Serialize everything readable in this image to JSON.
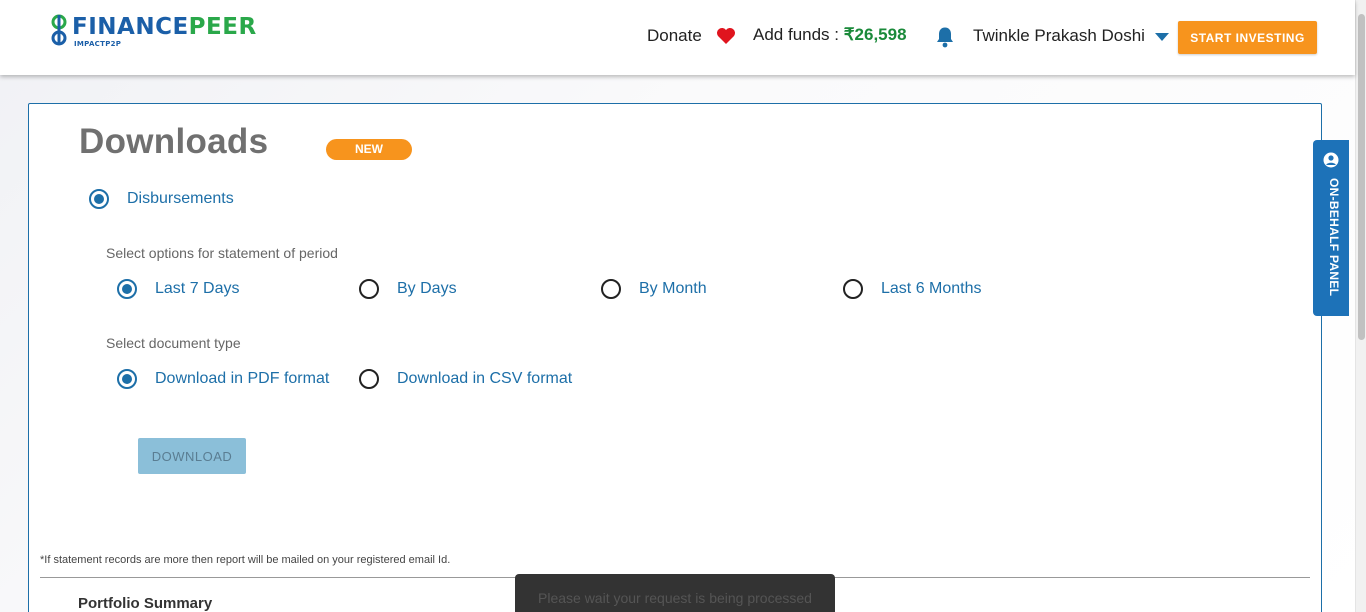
{
  "header": {
    "logo": {
      "brand_part1": "FINANCE",
      "brand_part2": "PEER",
      "tagline": "IMPACTP2P"
    },
    "donate_label": "Donate",
    "funds_label": "Add funds : ",
    "funds_amount": "₹26,598",
    "user_name": "Twinkle Prakash Doshi",
    "start_investing_label": "START INVESTING"
  },
  "page": {
    "title": "Downloads",
    "badge": "NEW",
    "report_type": {
      "label": "Disbursements",
      "selected": true
    },
    "period": {
      "label": "Select options for statement of period",
      "options": [
        {
          "label": "Last 7 Days",
          "selected": true
        },
        {
          "label": "By Days",
          "selected": false
        },
        {
          "label": "By Month",
          "selected": false
        },
        {
          "label": "Last 6 Months",
          "selected": false
        }
      ]
    },
    "doc_type": {
      "label": "Select document type",
      "options": [
        {
          "label": "Download in PDF format",
          "selected": true
        },
        {
          "label": "Download in CSV format",
          "selected": false
        }
      ]
    },
    "download_button": "DOWNLOAD",
    "note": "*If statement records are more then report will be mailed on your registered email Id.",
    "portfolio_title": "Portfolio Summary"
  },
  "side_panel": {
    "label": "ON-BEHALF PANEL"
  },
  "toast": {
    "message": "Please wait your request is being processed"
  },
  "colors": {
    "primary": "#1d6fa8",
    "accent": "#f7941d",
    "funds": "#1a8a3a",
    "heart": "#e0141e"
  }
}
